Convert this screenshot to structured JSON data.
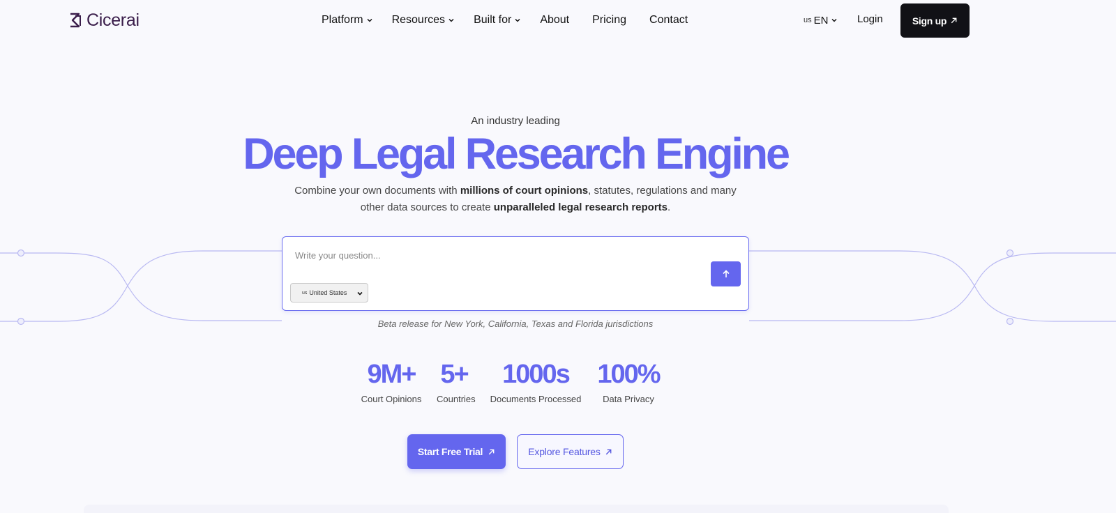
{
  "brand": {
    "name": "Cicerai",
    "accent": "#6466ee",
    "logo_color": "#3a1d4a"
  },
  "nav": {
    "items": [
      {
        "label": "Platform",
        "dropdown": true
      },
      {
        "label": "Resources",
        "dropdown": true
      },
      {
        "label": "Built for",
        "dropdown": true
      },
      {
        "label": "About",
        "dropdown": false
      },
      {
        "label": "Pricing",
        "dropdown": false
      },
      {
        "label": "Contact",
        "dropdown": false
      }
    ],
    "language": {
      "flag": "us",
      "code": "EN"
    },
    "login_label": "Login",
    "signup_label": "Sign up"
  },
  "hero": {
    "eyebrow": "An industry leading",
    "headline": "Deep Legal Research Engine",
    "sub_1": "Combine your own documents with ",
    "sub_bold_1": "millions of court opinions",
    "sub_2": ", statutes, regulations and many other data sources to create ",
    "sub_bold_2": "unparalleled legal research reports",
    "sub_3": "."
  },
  "search": {
    "placeholder": "Write your question...",
    "jurisdiction_flag": "us",
    "jurisdiction": "United States",
    "send_icon": "arrow-up-icon"
  },
  "beta_note": "Beta release for New York, California, Texas and Florida jurisdictions",
  "stats": [
    {
      "value": "9M+",
      "label": "Court Opinions"
    },
    {
      "value": "5+",
      "label": "Countries"
    },
    {
      "value": "1000s",
      "label": "Documents Processed"
    },
    {
      "value": "100%",
      "label": "Data Privacy"
    }
  ],
  "cta": {
    "primary_label": "Start Free Trial",
    "secondary_label": "Explore Features"
  }
}
